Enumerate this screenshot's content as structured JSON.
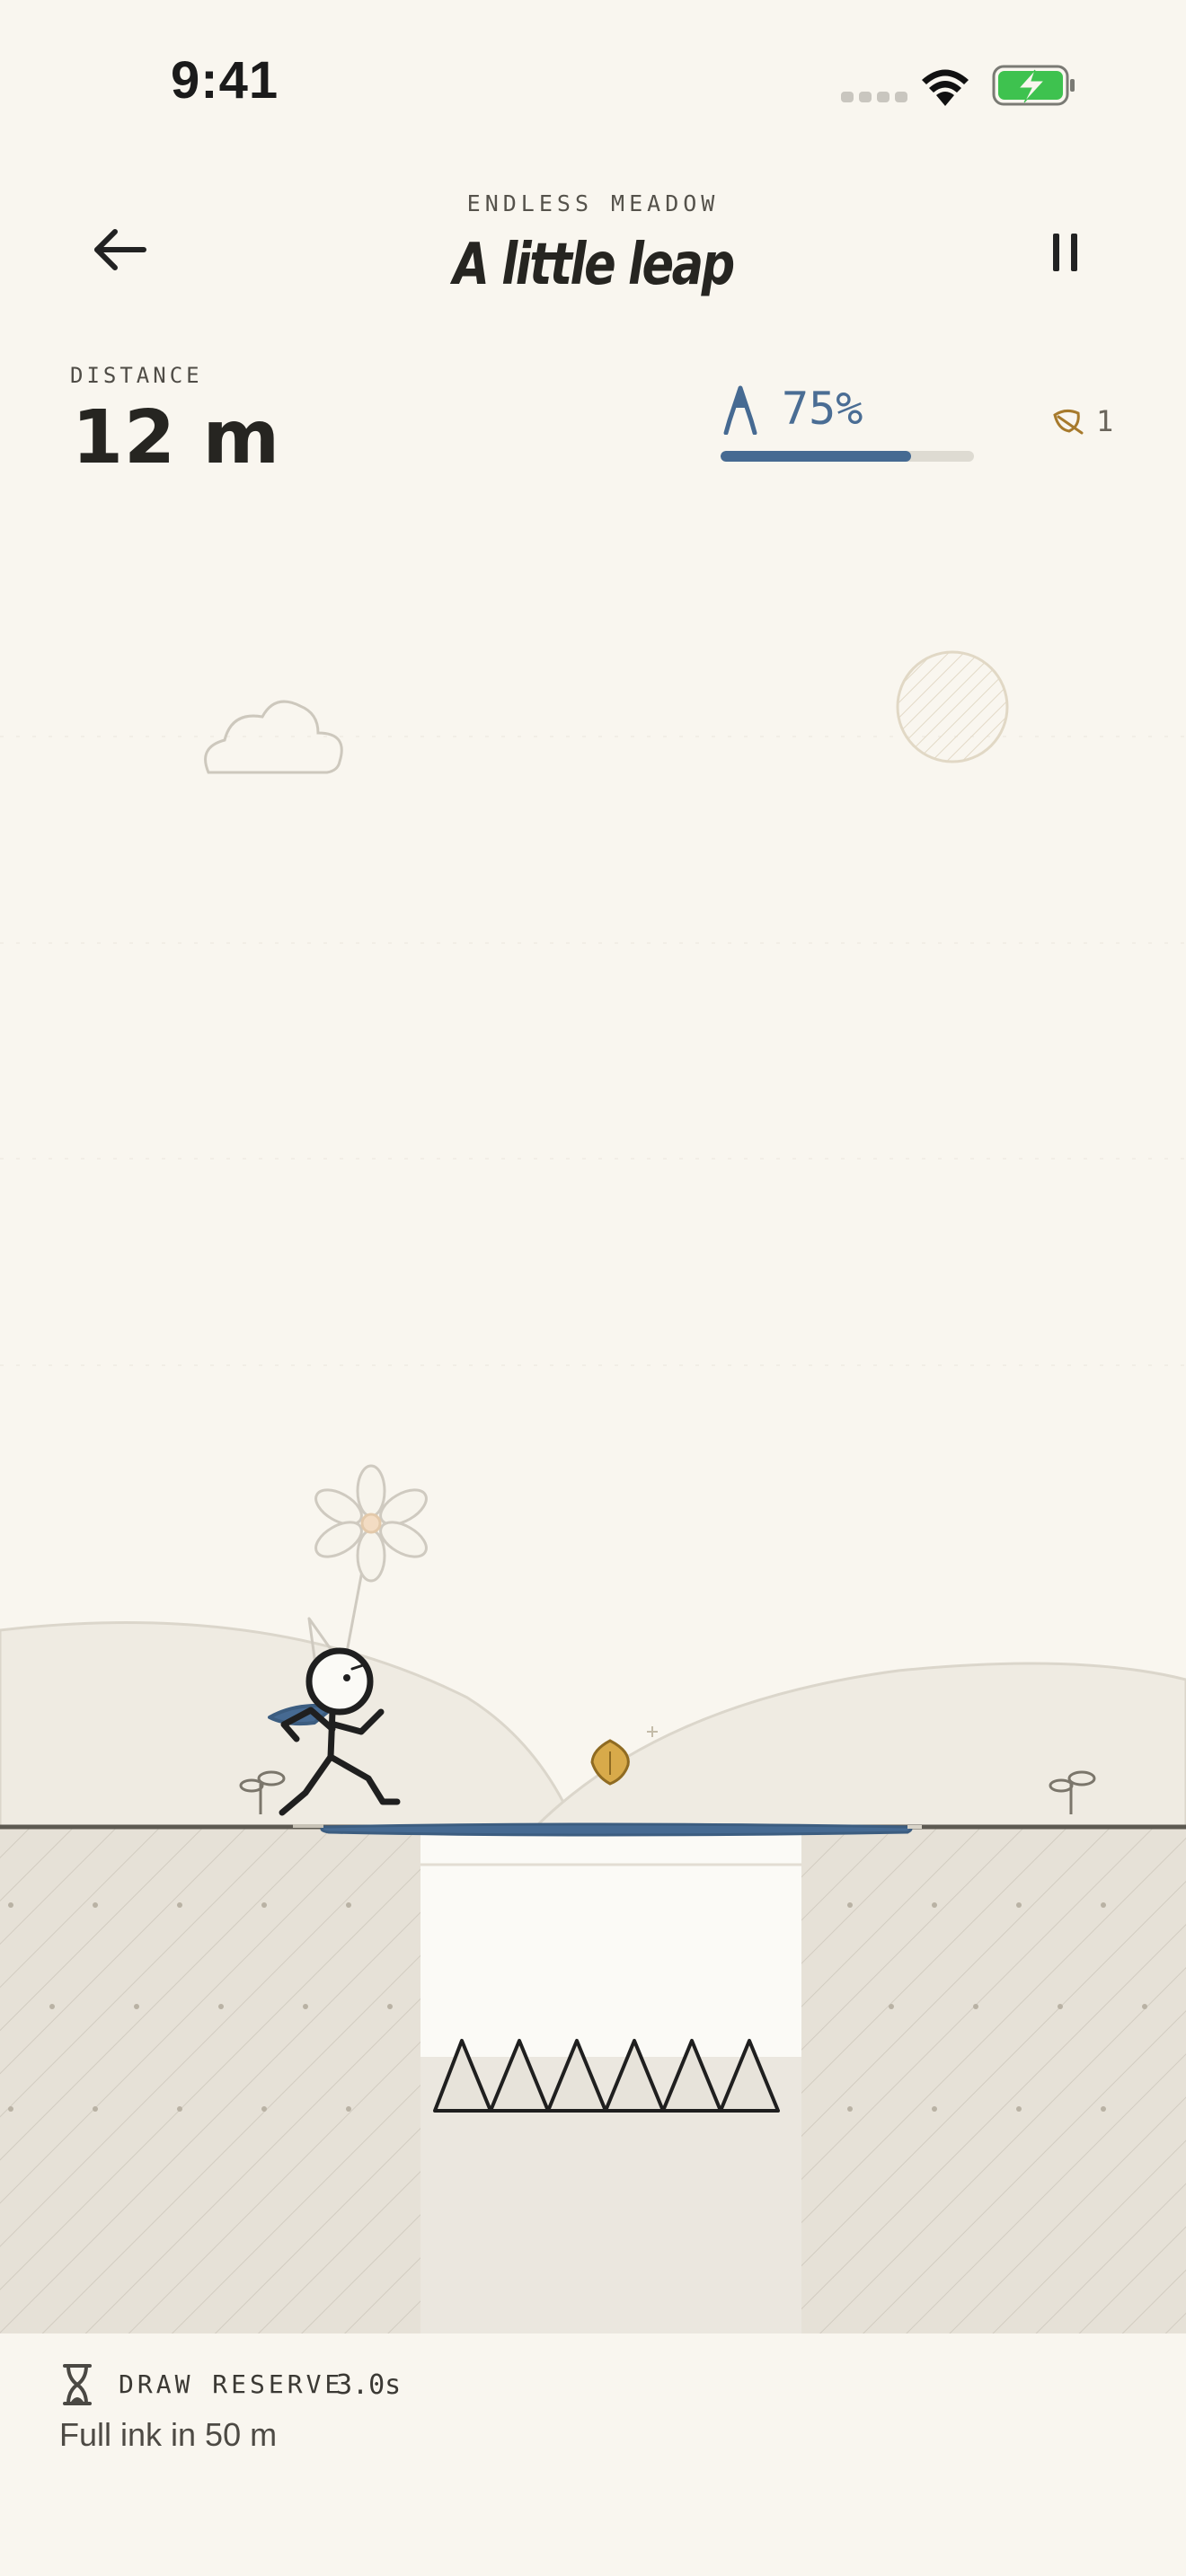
{
  "status_bar": {
    "time": "9:41",
    "icons": [
      "signal-dots-icon",
      "wifi-icon",
      "battery-charging-icon"
    ],
    "battery_color": "#3ec24f"
  },
  "header": {
    "mode": "ENDLESS MEADOW",
    "title": "A little leap",
    "back_icon": "arrow-left-icon",
    "pause_icon": "pause-icon"
  },
  "hud": {
    "distance_label": "DISTANCE",
    "distance_value": "12 m",
    "ink_icon": "pen-nib-icon",
    "ink_percent_label": "75%",
    "ink_level": 0.75,
    "leaf_icon": "leaf-icon",
    "leaf_count": "1"
  },
  "footer": {
    "hourglass_icon": "hourglass-icon",
    "reserve_label": "DRAW RESERVE",
    "reserve_value": "3.0s",
    "full_ink_text": "Full ink in 50 m"
  },
  "colors": {
    "background": "#f9f6ef",
    "ink_blue": "#466a92",
    "ground_fill": "#e6e1d7",
    "leaf_gold": "#d8aa4a"
  }
}
